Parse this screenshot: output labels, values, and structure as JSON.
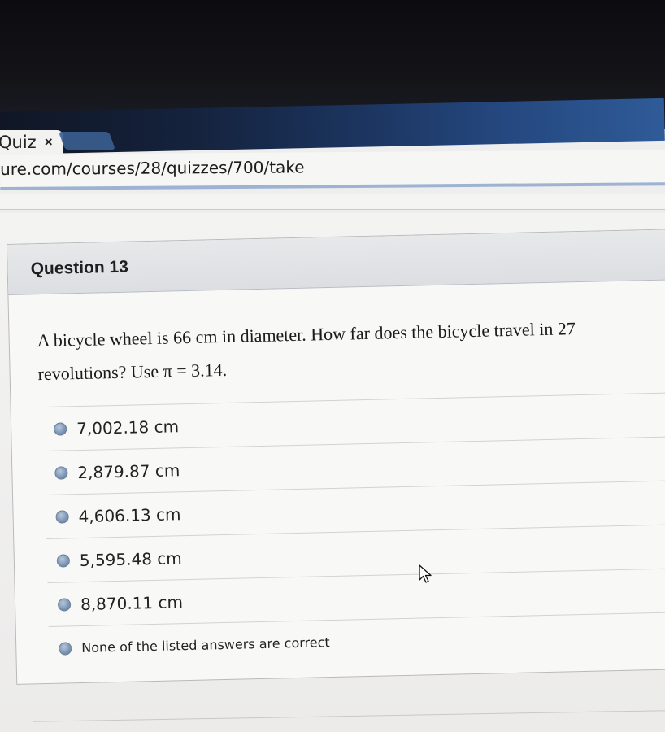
{
  "browser": {
    "tab_title": "Quiz",
    "tab_close": "×",
    "url": "ure.com/courses/28/quizzes/700/take"
  },
  "question": {
    "title": "Question 13",
    "text": "A bicycle wheel is 66 cm in diameter. How far does the bicycle travel in 27 revolutions? Use π = 3.14.",
    "answers": [
      {
        "label": "7,002.18 cm"
      },
      {
        "label": "2,879.87 cm"
      },
      {
        "label": "4,606.13 cm"
      },
      {
        "label": "5,595.48 cm"
      },
      {
        "label": "8,870.11 cm"
      },
      {
        "label": "None of the listed answers are correct"
      }
    ]
  }
}
